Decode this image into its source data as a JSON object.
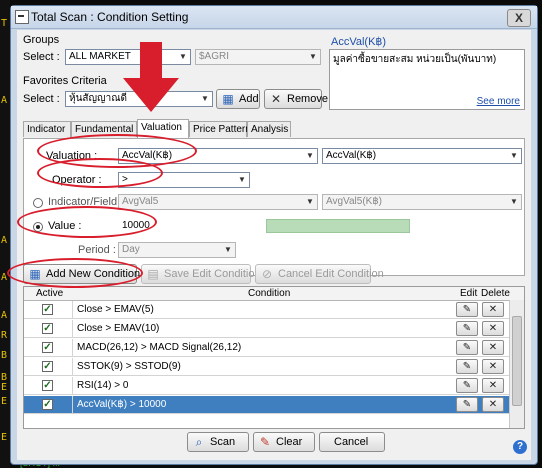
{
  "window": {
    "title": "Total Scan : Condition Setting",
    "close_label": "X"
  },
  "background": {
    "left_letters": [
      "T",
      "A",
      "A",
      "A",
      "A",
      "R",
      "B",
      "B",
      "E",
      "E",
      "E"
    ],
    "bottom_text": "[SHOT] ..."
  },
  "groups": {
    "section_label": "Groups",
    "select_label": "Select :",
    "market_value": "ALL MARKET",
    "sub_value": "$AGRI"
  },
  "favorites": {
    "section_label": "Favorites Criteria",
    "select_label": "Select :",
    "value": "หุ้นสัญญาณดี",
    "add_label": "Add",
    "remove_label": "Remove"
  },
  "info": {
    "title": "AccVal(K฿)",
    "description": "มูลค่าซื้อขายสะสม หน่วยเป็น(พันบาท)",
    "see_more": "See more"
  },
  "tabs": [
    {
      "label": "Indicator",
      "active": false
    },
    {
      "label": "Fundamental",
      "active": false
    },
    {
      "label": "Valuation",
      "active": true
    },
    {
      "label": "Price Pattern",
      "active": false
    },
    {
      "label": "Analysis",
      "active": false
    }
  ],
  "valuation": {
    "label": "Valuation :",
    "value": "AccVal(K฿)",
    "compare_value": "AccVal(K฿)",
    "operator_label": "Operator :",
    "operator_value": ">",
    "indicator_label": "Indicator/Field :",
    "indicator_value": "AvgVal5",
    "indicator_compare": "AvgVal5(K฿)",
    "value_label": "Value :",
    "value_input": "10000",
    "period_label": "Period :",
    "period_value": "Day"
  },
  "actions": {
    "add_new": "Add New Condition",
    "save_edit": "Save Edit Condition",
    "cancel_edit": "Cancel Edit Condition"
  },
  "grid": {
    "headers": {
      "active": "Active",
      "condition": "Condition",
      "edit": "Edit",
      "delete": "Delete"
    },
    "rows": [
      {
        "condition": "Close > EMAV(5)",
        "checked": true,
        "selected": false
      },
      {
        "condition": "Close > EMAV(10)",
        "checked": true,
        "selected": false
      },
      {
        "condition": "MACD(26,12) > MACD Signal(26,12)",
        "checked": true,
        "selected": false
      },
      {
        "condition": "SSTOK(9) > SSTOD(9)",
        "checked": true,
        "selected": false
      },
      {
        "condition": "RSI(14) > 0",
        "checked": true,
        "selected": false
      },
      {
        "condition": "AccVal(K฿) > 10000",
        "checked": true,
        "selected": true
      }
    ]
  },
  "footer": {
    "scan": "Scan",
    "clear": "Clear",
    "cancel": "Cancel",
    "help": "?"
  },
  "colors": {
    "annotation": "#d81e2c",
    "selected_row": "#3f7fc0",
    "title_bg": "#c9d6e6"
  }
}
